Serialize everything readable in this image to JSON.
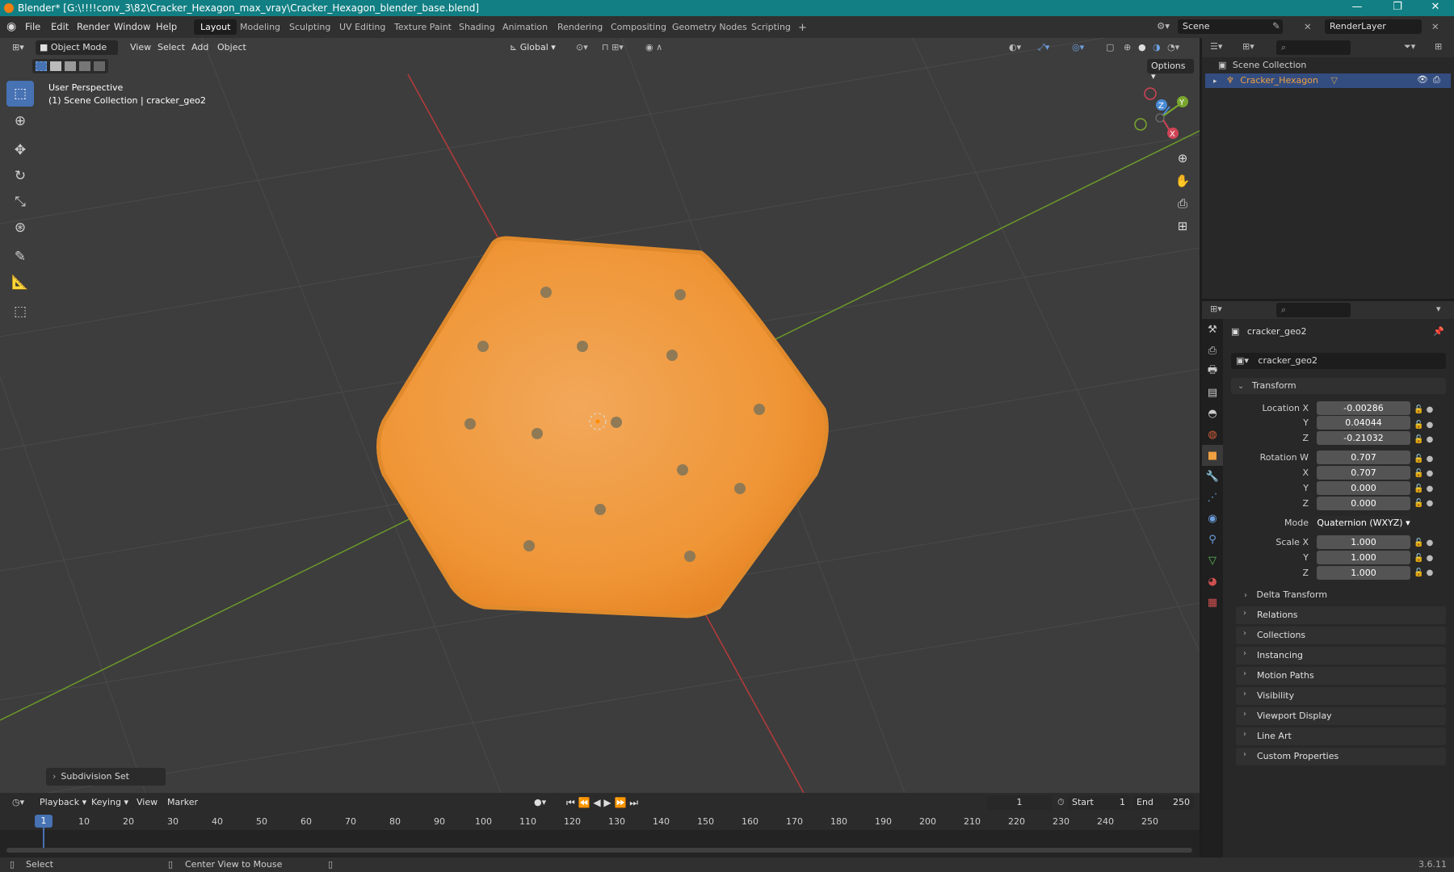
{
  "window": {
    "title": "Blender* [G:\\!!!!conv_3\\82\\Cracker_Hexagon_max_vray\\Cracker_Hexagon_blender_base.blend]",
    "minimize": "—",
    "maximize": "❐",
    "close": "✕"
  },
  "menu": [
    "File",
    "Edit",
    "Render",
    "Window",
    "Help"
  ],
  "workspaces": [
    "Layout",
    "Modeling",
    "Sculpting",
    "UV Editing",
    "Texture Paint",
    "Shading",
    "Animation",
    "Rendering",
    "Compositing",
    "Geometry Nodes",
    "Scripting"
  ],
  "add_workspace": "+",
  "scene": {
    "name": "Scene",
    "render_layer": "RenderLayer"
  },
  "viewport_header": {
    "mode": "Object Mode",
    "menus": [
      "View",
      "Select",
      "Add",
      "Object"
    ],
    "orientation": "Global",
    "options": "Options"
  },
  "viewport": {
    "perspective": "User Perspective",
    "collection_line": "(1) Scene Collection | cracker_geo2",
    "gizmo": {
      "x": "X",
      "y": "Y",
      "z": "Z"
    },
    "operator_panel": "Subdivision Set"
  },
  "outliner": {
    "root": "Scene Collection",
    "items": [
      {
        "label": "Cracker_Hexagon"
      }
    ]
  },
  "properties": {
    "object_name": "cracker_geo2",
    "data_name": "cracker_geo2",
    "transform": {
      "title": "Transform",
      "location_label": "Location X",
      "location": [
        "-0.00286",
        "0.04044",
        "-0.21032"
      ],
      "rotation_label": "Rotation W",
      "rotation": [
        "0.707",
        "0.707",
        "0.000",
        "0.000"
      ],
      "mode_label": "Mode",
      "mode": "Quaternion (WXYZ)",
      "scale_label": "Scale X",
      "scale": [
        "1.000",
        "1.000",
        "1.000"
      ],
      "axis_y": "Y",
      "axis_z": "Z",
      "axis_x": "X"
    },
    "delta_transform": "Delta Transform",
    "sections": [
      "Relations",
      "Collections",
      "Instancing",
      "Motion Paths",
      "Visibility",
      "Viewport Display",
      "Line Art",
      "Custom Properties"
    ]
  },
  "timeline": {
    "menus": [
      "Playback",
      "Keying",
      "View",
      "Marker"
    ],
    "current_frame": "1",
    "start_label": "Start",
    "start": "1",
    "end_label": "End",
    "end": "250",
    "ticks": [
      "1",
      "10",
      "20",
      "30",
      "40",
      "50",
      "60",
      "70",
      "80",
      "90",
      "100",
      "110",
      "120",
      "130",
      "140",
      "150",
      "160",
      "170",
      "180",
      "190",
      "200",
      "210",
      "220",
      "230",
      "240",
      "250"
    ]
  },
  "statusbar": {
    "select": "Select",
    "center_view": "Center View to Mouse",
    "version": "3.6.11"
  },
  "colors": {
    "accent": "#4772b3",
    "title_bar": "#117f83",
    "blender_orange": "#f07d12",
    "cracker": "#f0a040",
    "axis_x": "#c83737",
    "axis_y": "#6b9a2a"
  }
}
